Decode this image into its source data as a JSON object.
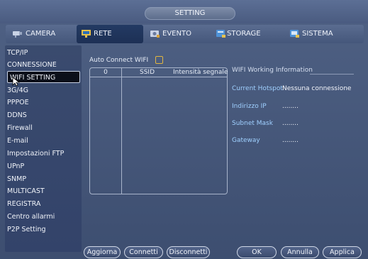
{
  "window": {
    "title": "SETTING"
  },
  "tabs": [
    {
      "label": "CAMERA",
      "icon": "camera-icon",
      "active": false
    },
    {
      "label": "RETE",
      "icon": "network-icon",
      "active": true
    },
    {
      "label": "EVENTO",
      "icon": "event-icon",
      "active": false
    },
    {
      "label": "STORAGE",
      "icon": "storage-icon",
      "active": false
    },
    {
      "label": "SISTEMA",
      "icon": "system-icon",
      "active": false
    }
  ],
  "sidebar": {
    "items": [
      {
        "label": "TCP/IP"
      },
      {
        "label": "CONNESSIONE"
      },
      {
        "label": "WIFI SETTING",
        "selected": true
      },
      {
        "label": "3G/4G"
      },
      {
        "label": "PPPOE"
      },
      {
        "label": "DDNS"
      },
      {
        "label": "Firewall"
      },
      {
        "label": "E-mail"
      },
      {
        "label": "Impostazioni FTP"
      },
      {
        "label": "UPnP"
      },
      {
        "label": "SNMP"
      },
      {
        "label": "MULTICAST"
      },
      {
        "label": "REGISTRA"
      },
      {
        "label": "Centro allarmi"
      },
      {
        "label": "P2P Setting"
      }
    ]
  },
  "wifi": {
    "auto_connect_label": "Auto Connect WIFI",
    "auto_connect_checked": false,
    "table": {
      "columns": [
        "0",
        "SSID",
        "Intensità segnale"
      ],
      "rows": []
    },
    "info": {
      "heading": "WIFI Working Information",
      "current_hotspot_label": "Current Hotspot",
      "current_hotspot_value": "Nessuna connessione",
      "ip_label": "Indirizzo IP",
      "ip_value": "........",
      "subnet_label": "Subnet Mask",
      "subnet_value": "........",
      "gateway_label": "Gateway",
      "gateway_value": "........"
    }
  },
  "buttons": {
    "refresh": "Aggiorna",
    "connect": "Connetti",
    "disconnect": "Disconnetti",
    "ok": "OK",
    "cancel": "Annulla",
    "apply": "Applica"
  },
  "colors": {
    "background": "#3d4e70",
    "active_tab": "#1d3055",
    "selected_item": "#0b0f19",
    "info_label": "#9fd0ff",
    "checkbox_border": "#e2b640"
  }
}
